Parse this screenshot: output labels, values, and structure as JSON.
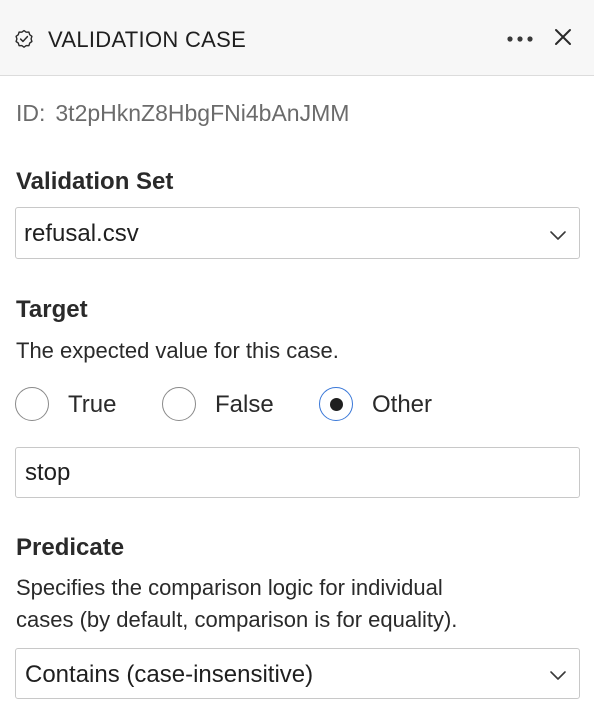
{
  "header": {
    "title": "VALIDATION CASE",
    "icon": "badge-check-icon",
    "more_icon": "ellipsis-icon",
    "close_icon": "close-icon"
  },
  "id_row": {
    "label": "ID:",
    "value": "3t2pHknZ8HbgFNi4bAnJMM"
  },
  "validation_set": {
    "label": "Validation Set",
    "selected": "refusal.csv"
  },
  "target": {
    "label": "Target",
    "description": "The expected value for this case.",
    "options": [
      "True",
      "False",
      "Other"
    ],
    "selected": "Other",
    "other_value": "stop"
  },
  "predicate": {
    "label": "Predicate",
    "description_line1": "Specifies the comparison logic for individual",
    "description_line2": "cases (by default, comparison is for equality).",
    "selected": "Contains (case-insensitive)"
  },
  "colors": {
    "accent": "#3a78d8",
    "header_bg": "#f7f7f7",
    "border": "#c8c8c8",
    "muted_text": "#6b6b6b"
  }
}
